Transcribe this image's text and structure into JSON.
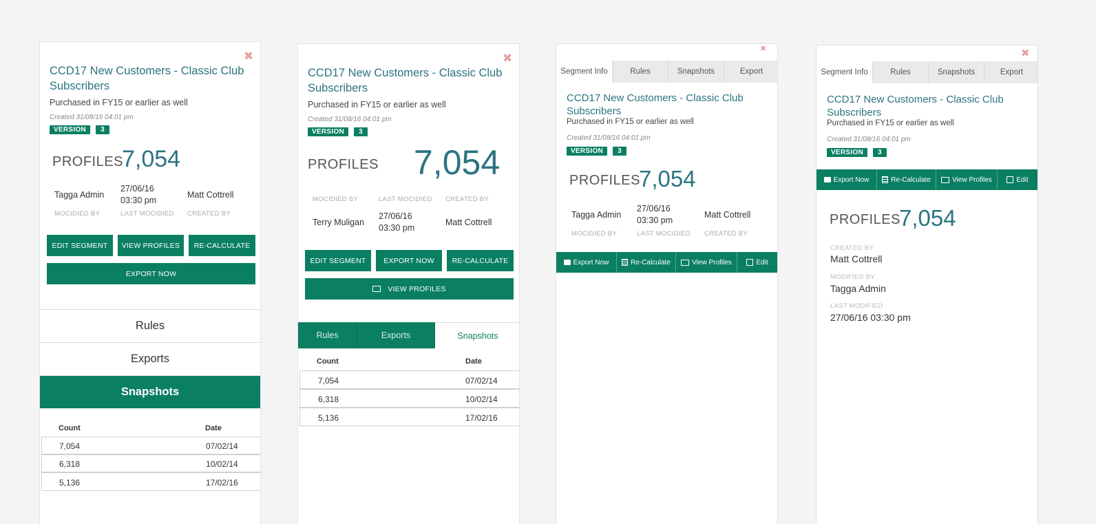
{
  "common": {
    "close": "✖",
    "title": "CCD17 New Customers - Classic Club Subscribers",
    "subtitle": "Purchased in FY15 or earlier as well",
    "created": "Created 31/08/16 04:01 pm",
    "version_label": "VERSION",
    "version_num": "3",
    "profiles_label": "PROFILES",
    "profiles_count": "7,054"
  },
  "meta": {
    "modified_by_label": "MOCIDIED BY",
    "last_modified_label": "LAST MOCIDIED",
    "created_by_label": "CREATED BY",
    "modified_by": "Tagga Admin",
    "modified_by_2": "Terry Muligan",
    "last_modified": "27/06/16 03:30 pm",
    "created_by": "Matt Cottrell"
  },
  "buttons": {
    "edit_segment": "EDIT SEGMENT",
    "view_profiles": "VIEW PROFILES",
    "recalculate": "RE-CALCULATE",
    "export_now": "EXPORT NOW"
  },
  "accordion": {
    "rules": "Rules",
    "exports": "Exports",
    "snapshots": "Snapshots"
  },
  "snapshots": {
    "count_header": "Count",
    "date_header": "Date",
    "rows": [
      {
        "count": "7,054",
        "date": "07/02/14"
      },
      {
        "count": "6,318",
        "date": "10/02/14"
      },
      {
        "count": "5,136",
        "date": "17/02/16"
      }
    ]
  },
  "tabs": {
    "segment_info": "Segment Info",
    "rules": "Rules",
    "snapshots": "Snapshots",
    "export": "Export"
  },
  "actionbar": {
    "export_now": "Export Now",
    "recalculate": "Re-Calculate",
    "view_profiles": "View Profiles",
    "edit": "Edit"
  },
  "details": {
    "created_by_label": "CREATED BY",
    "created_by": "Matt Cottrell",
    "modified_by_label": "MODIFIED BY",
    "modified_by": "Tagga Admin",
    "last_modified_label": "LAST MODIFIED",
    "last_modified": "27/06/16 03:30 pm"
  }
}
